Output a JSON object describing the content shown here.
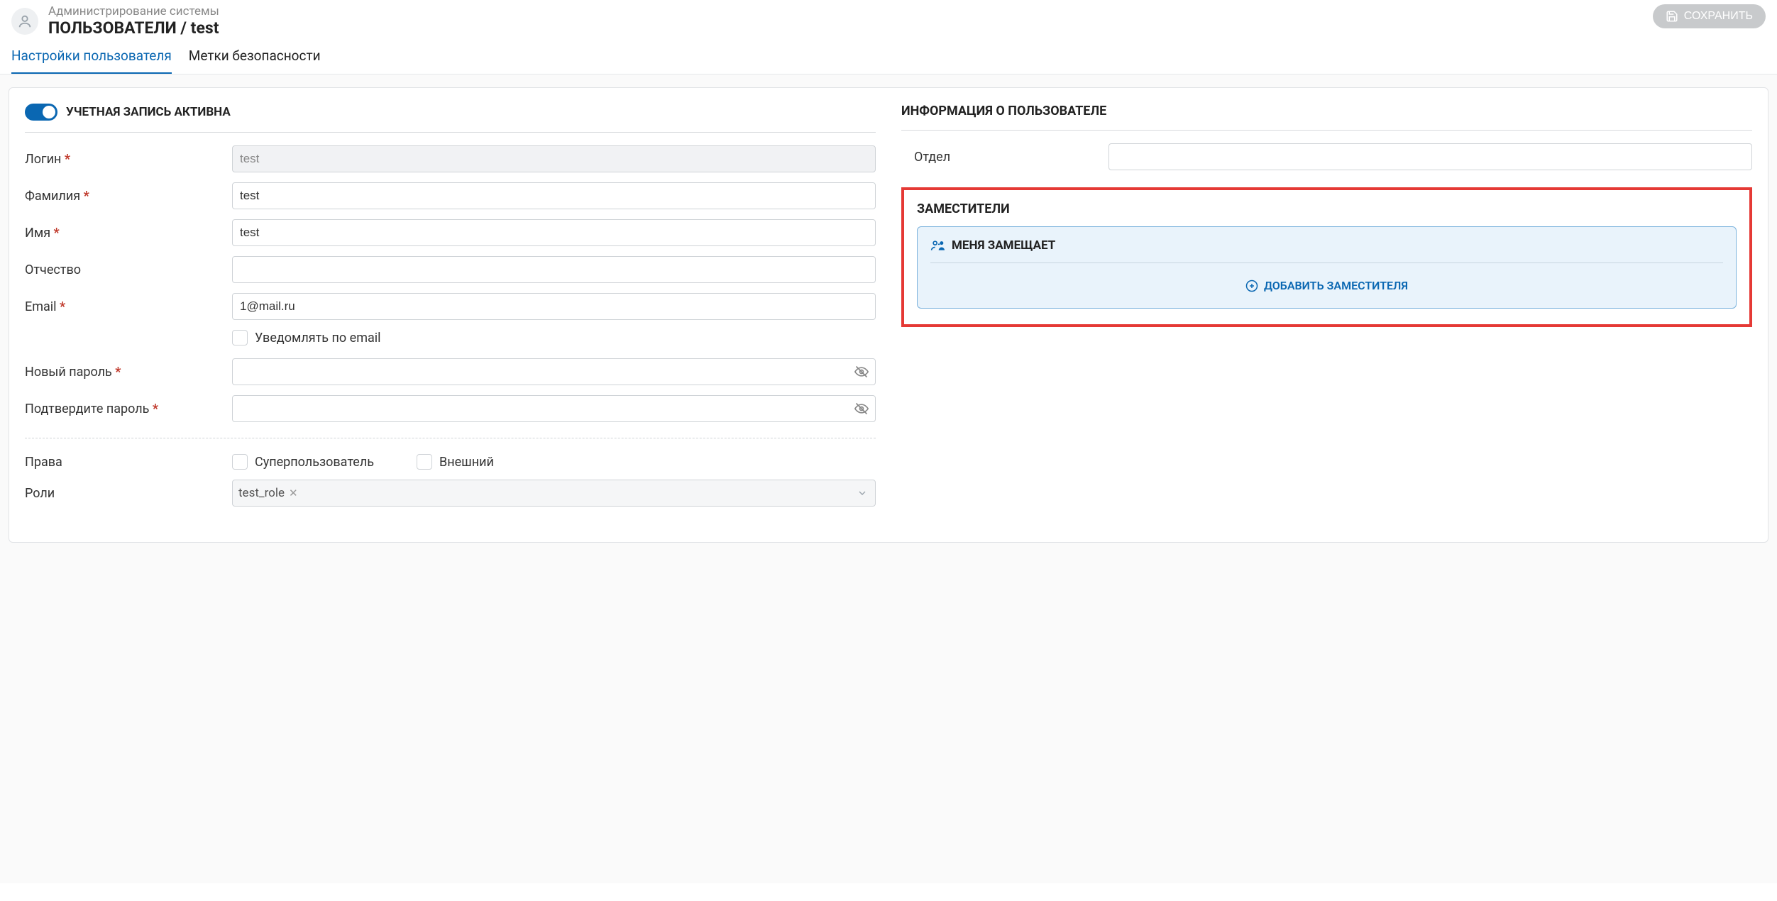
{
  "header": {
    "subtitle": "Администрирование системы",
    "title": "ПОЛЬЗОВАТЕЛИ / test",
    "save_label": "СОХРАНИТЬ"
  },
  "tabs": {
    "settings": "Настройки пользователя",
    "security": "Метки безопасности"
  },
  "left": {
    "active_label": "УЧЕТНАЯ ЗАПИСЬ АКТИВНА",
    "login_label": "Логин",
    "login_value": "test",
    "lastname_label": "Фамилия",
    "lastname_value": "test",
    "firstname_label": "Имя",
    "firstname_value": "test",
    "middlename_label": "Отчество",
    "middlename_value": "",
    "email_label": "Email",
    "email_value": "1@mail.ru",
    "notify_label": "Уведомлять по email",
    "newpass_label": "Новый пароль",
    "confirmpass_label": "Подтвердите пароль",
    "rights_label": "Права",
    "superuser_label": "Суперпользователь",
    "external_label": "Внешний",
    "roles_label": "Роли",
    "role_tag": "test_role"
  },
  "right": {
    "info_header": "ИНФОРМАЦИЯ О ПОЛЬЗОВАТЕЛЕ",
    "department_label": "Отдел",
    "department_value": "",
    "deputies_header": "ЗАМЕСТИТЕЛИ",
    "deputy_title": "МЕНЯ ЗАМЕЩАЕТ",
    "add_deputy_label": "ДОБАВИТЬ ЗАМЕСТИТЕЛЯ"
  }
}
